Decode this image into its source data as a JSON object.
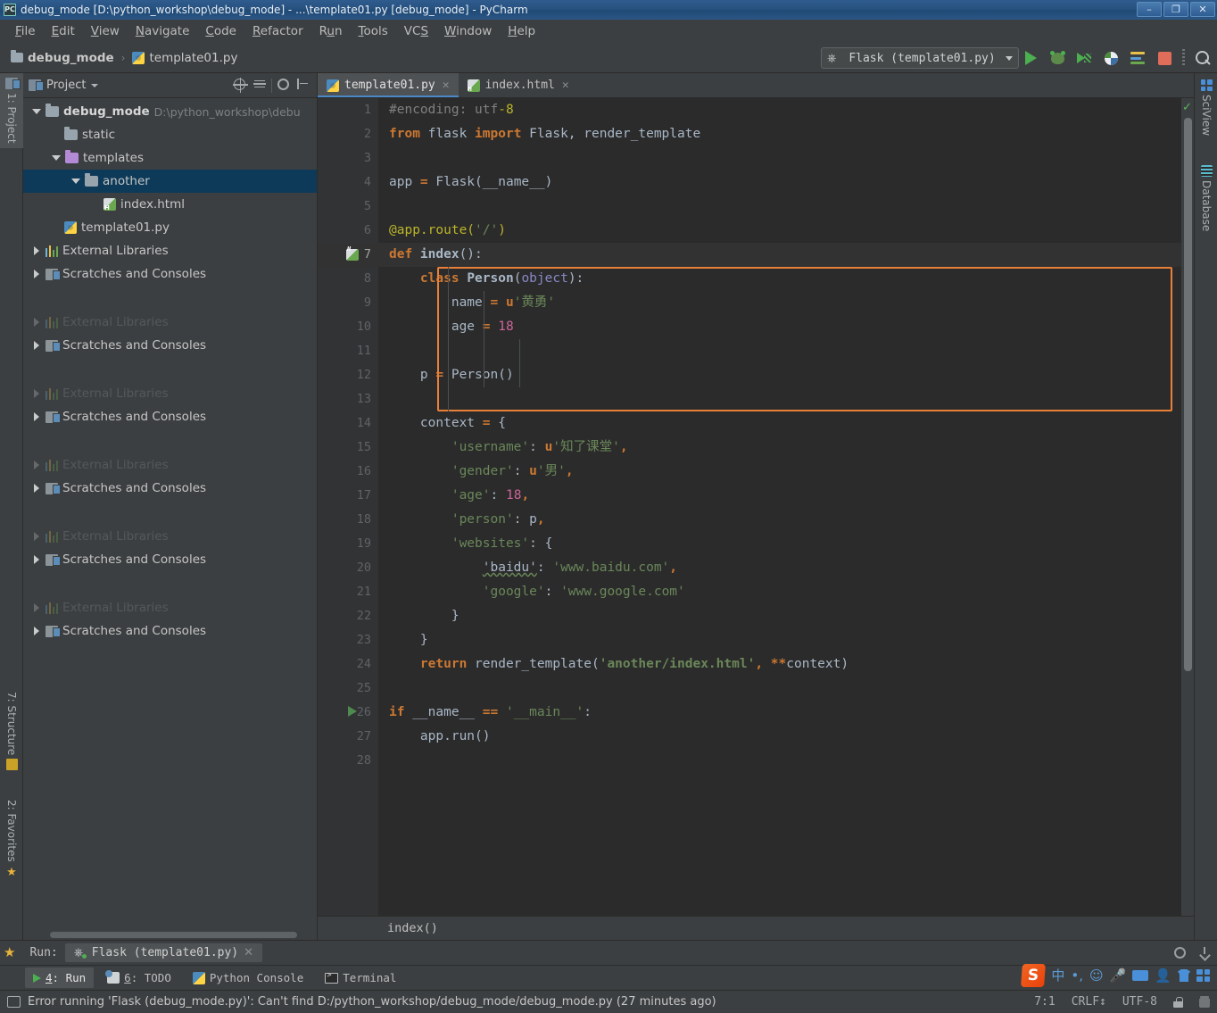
{
  "window": {
    "title": "debug_mode [D:\\python_workshop\\debug_mode] - ...\\template01.py [debug_mode] - PyCharm",
    "app_icon": "PC",
    "minimize": "–",
    "restore": "❐",
    "close": "✕"
  },
  "menu": {
    "items": [
      {
        "label": "File"
      },
      {
        "label": "Edit"
      },
      {
        "label": "View"
      },
      {
        "label": "Navigate"
      },
      {
        "label": "Code"
      },
      {
        "label": "Refactor"
      },
      {
        "label": "Run"
      },
      {
        "label": "Tools"
      },
      {
        "label": "VCS"
      },
      {
        "label": "Window"
      },
      {
        "label": "Help"
      }
    ]
  },
  "navbar": {
    "crumbs": [
      {
        "label": "debug_mode",
        "icon": "folder-icon"
      },
      {
        "label": "template01.py",
        "icon": "python-file-icon"
      }
    ],
    "separator": "›",
    "run_config": "Flask (template01.py)",
    "actions": [
      {
        "name": "run-button",
        "tooltip": "Run"
      },
      {
        "name": "debug-button",
        "tooltip": "Debug"
      },
      {
        "name": "run-coverage-button",
        "tooltip": "Run with Coverage"
      },
      {
        "name": "profile-button",
        "tooltip": "Profile"
      },
      {
        "name": "run-console-button",
        "tooltip": "Console"
      },
      {
        "name": "stop-button",
        "tooltip": "Stop"
      },
      {
        "name": "search-everywhere-button",
        "tooltip": "Search"
      }
    ]
  },
  "left_strip": {
    "project_tab": "1: Project",
    "structure_tab": "7: Structure",
    "favorites_tab": "2: Favorites"
  },
  "right_strip": {
    "sciview_tab": "SciView",
    "database_tab": "Database"
  },
  "project_panel": {
    "title": "Project",
    "toolbar": [
      {
        "name": "locate-icon"
      },
      {
        "name": "collapse-all-icon"
      },
      {
        "name": "settings-gear-icon"
      },
      {
        "name": "hide-panel-icon"
      }
    ],
    "tree": [
      {
        "indent": 0,
        "arrow": "down",
        "icon": "folder-icon",
        "label": "debug_mode",
        "bold": true,
        "path": "D:\\python_workshop\\debu",
        "selected": false
      },
      {
        "indent": 1,
        "arrow": "none",
        "icon": "folder-icon",
        "label": "static",
        "bold": false,
        "path": "",
        "selected": false
      },
      {
        "indent": 1,
        "arrow": "down",
        "icon": "folder-purple-icon",
        "label": "templates",
        "bold": false,
        "path": "",
        "selected": false
      },
      {
        "indent": 2,
        "arrow": "down",
        "icon": "folder-icon",
        "label": "another",
        "bold": false,
        "path": "",
        "selected": true
      },
      {
        "indent": 3,
        "arrow": "none",
        "icon": "html-file-icon",
        "label": "index.html",
        "bold": false,
        "path": "",
        "selected": false
      },
      {
        "indent": 1,
        "arrow": "none",
        "icon": "python-file-icon",
        "label": "template01.py",
        "bold": false,
        "path": "",
        "selected": false
      },
      {
        "indent": 0,
        "arrow": "right",
        "icon": "libraries-icon",
        "label": "External Libraries",
        "bold": false,
        "path": "",
        "selected": false
      },
      {
        "indent": 0,
        "arrow": "right",
        "icon": "scratches-icon",
        "label": "Scratches and Consoles",
        "bold": false,
        "path": "",
        "selected": false
      }
    ],
    "ghost_groups": [
      {
        "library_label": "External Libraries",
        "scratch_label": "Scratches and Consoles"
      },
      {
        "library_label": "External Libraries",
        "scratch_label": "Scratches and Consoles"
      },
      {
        "library_label": "External Libraries",
        "scratch_label": "Scratches and Consoles"
      },
      {
        "library_label": "External Libraries",
        "scratch_label": "Scratches and Consoles"
      },
      {
        "library_label": "External Libraries",
        "scratch_label": "Scratches and Consoles"
      }
    ]
  },
  "editor": {
    "tabs": [
      {
        "label": "template01.py",
        "icon": "python-file-icon",
        "active": true,
        "close": "✕"
      },
      {
        "label": "index.html",
        "icon": "html-file-icon",
        "active": false,
        "close": "✕"
      }
    ],
    "current_line": 7,
    "breadcrumb": "index()",
    "inspection_status": "ok",
    "lines": [
      {
        "n": 1,
        "tokens": [
          {
            "t": "#encoding: ",
            "c": "cmt"
          },
          {
            "t": "utf",
            "c": "cmt"
          },
          {
            "t": "-8",
            "c": "enc"
          }
        ],
        "indent": 0
      },
      {
        "n": 2,
        "tokens": [
          {
            "t": "from ",
            "c": "k"
          },
          {
            "t": "flask ",
            "c": "plain"
          },
          {
            "t": "import ",
            "c": "k"
          },
          {
            "t": "Flask, render_template",
            "c": "plain"
          }
        ],
        "indent": 0
      },
      {
        "n": 3,
        "tokens": [],
        "indent": 0
      },
      {
        "n": 4,
        "tokens": [
          {
            "t": "app ",
            "c": "plain"
          },
          {
            "t": "= ",
            "c": "k"
          },
          {
            "t": "Flask(__name__)",
            "c": "plain"
          }
        ],
        "indent": 0
      },
      {
        "n": 5,
        "tokens": [],
        "indent": 0
      },
      {
        "n": 6,
        "tokens": [
          {
            "t": "@app.route(",
            "c": "deco"
          },
          {
            "t": "'/'",
            "c": "str"
          },
          {
            "t": ")",
            "c": "deco"
          }
        ],
        "indent": 0
      },
      {
        "n": 7,
        "tokens": [
          {
            "t": "def ",
            "c": "k"
          },
          {
            "t": "index",
            "c": "cls"
          },
          {
            "t": "():",
            "c": "plain"
          }
        ],
        "indent": 0,
        "gutter_icon": "html-file-icon"
      },
      {
        "n": 8,
        "tokens": [
          {
            "t": "    ",
            "c": "plain"
          },
          {
            "t": "class ",
            "c": "k"
          },
          {
            "t": "Person",
            "c": "cls"
          },
          {
            "t": "(",
            "c": "plain"
          },
          {
            "t": "object",
            "c": "bi"
          },
          {
            "t": "):",
            "c": "plain"
          }
        ],
        "indent": 1
      },
      {
        "n": 9,
        "tokens": [
          {
            "t": "        name ",
            "c": "plain"
          },
          {
            "t": "= ",
            "c": "k"
          },
          {
            "t": "u",
            "c": "k"
          },
          {
            "t": "'黄勇'",
            "c": "str"
          }
        ],
        "indent": 2
      },
      {
        "n": 10,
        "tokens": [
          {
            "t": "        age ",
            "c": "plain"
          },
          {
            "t": "= ",
            "c": "k"
          },
          {
            "t": "18",
            "c": "numpink"
          }
        ],
        "indent": 2
      },
      {
        "n": 11,
        "tokens": [],
        "indent": 0
      },
      {
        "n": 12,
        "tokens": [
          {
            "t": "    p ",
            "c": "plain"
          },
          {
            "t": "= ",
            "c": "k"
          },
          {
            "t": "Person()",
            "c": "plain"
          }
        ],
        "indent": 1
      },
      {
        "n": 13,
        "tokens": [],
        "indent": 0
      },
      {
        "n": 14,
        "tokens": [
          {
            "t": "    context ",
            "c": "plain"
          },
          {
            "t": "= ",
            "c": "k"
          },
          {
            "t": "{",
            "c": "plain"
          }
        ],
        "indent": 1
      },
      {
        "n": 15,
        "tokens": [
          {
            "t": "        ",
            "c": "plain"
          },
          {
            "t": "'username'",
            "c": "str"
          },
          {
            "t": ": ",
            "c": "plain"
          },
          {
            "t": "u",
            "c": "k"
          },
          {
            "t": "'知了课堂'",
            "c": "str"
          },
          {
            "t": ",",
            "c": "k"
          }
        ],
        "indent": 2
      },
      {
        "n": 16,
        "tokens": [
          {
            "t": "        ",
            "c": "plain"
          },
          {
            "t": "'gender'",
            "c": "str"
          },
          {
            "t": ": ",
            "c": "plain"
          },
          {
            "t": "u",
            "c": "k"
          },
          {
            "t": "'男'",
            "c": "str"
          },
          {
            "t": ",",
            "c": "k"
          }
        ],
        "indent": 2
      },
      {
        "n": 17,
        "tokens": [
          {
            "t": "        ",
            "c": "plain"
          },
          {
            "t": "'age'",
            "c": "str"
          },
          {
            "t": ": ",
            "c": "plain"
          },
          {
            "t": "18",
            "c": "numpink"
          },
          {
            "t": ",",
            "c": "k"
          }
        ],
        "indent": 2
      },
      {
        "n": 18,
        "tokens": [
          {
            "t": "        ",
            "c": "plain"
          },
          {
            "t": "'person'",
            "c": "str"
          },
          {
            "t": ": p",
            "c": "plain"
          },
          {
            "t": ",",
            "c": "k"
          }
        ],
        "indent": 2
      },
      {
        "n": 19,
        "tokens": [
          {
            "t": "        ",
            "c": "plain"
          },
          {
            "t": "'websites'",
            "c": "str"
          },
          {
            "t": ": {",
            "c": "plain"
          }
        ],
        "indent": 2
      },
      {
        "n": 20,
        "tokens": [
          {
            "t": "            ",
            "c": "plain"
          },
          {
            "t": "'baidu'",
            "c": "spell"
          },
          {
            "t": ": ",
            "c": "plain"
          },
          {
            "t": "'www.baidu.com'",
            "c": "str"
          },
          {
            "t": ",",
            "c": "k"
          }
        ],
        "indent": 3
      },
      {
        "n": 21,
        "tokens": [
          {
            "t": "            ",
            "c": "plain"
          },
          {
            "t": "'google'",
            "c": "str"
          },
          {
            "t": ": ",
            "c": "plain"
          },
          {
            "t": "'www.google.com'",
            "c": "str"
          }
        ],
        "indent": 3
      },
      {
        "n": 22,
        "tokens": [
          {
            "t": "        }",
            "c": "plain"
          }
        ],
        "indent": 2
      },
      {
        "n": 23,
        "tokens": [
          {
            "t": "    }",
            "c": "plain"
          }
        ],
        "indent": 1
      },
      {
        "n": 24,
        "tokens": [
          {
            "t": "    ",
            "c": "plain"
          },
          {
            "t": "return ",
            "c": "k"
          },
          {
            "t": "render_template(",
            "c": "plain"
          },
          {
            "t": "'another/index.html'",
            "c": "hl-str"
          },
          {
            "t": ", ",
            "c": "k"
          },
          {
            "t": "**",
            "c": "k"
          },
          {
            "t": "context)",
            "c": "plain"
          }
        ],
        "indent": 1
      },
      {
        "n": 25,
        "tokens": [],
        "indent": 0
      },
      {
        "n": 26,
        "tokens": [
          {
            "t": "if ",
            "c": "k"
          },
          {
            "t": "__name__ ",
            "c": "plain"
          },
          {
            "t": "== ",
            "c": "k"
          },
          {
            "t": "'__main__'",
            "c": "str"
          },
          {
            "t": ":",
            "c": "plain"
          }
        ],
        "indent": 0,
        "gutter_icon": "run-marker-icon"
      },
      {
        "n": 27,
        "tokens": [
          {
            "t": "    app.run()",
            "c": "plain"
          }
        ],
        "indent": 1
      },
      {
        "n": 28,
        "tokens": [],
        "indent": 0
      }
    ]
  },
  "run_panel": {
    "label": "Run:",
    "tab_label": "Flask (template01.py)",
    "close": "✕",
    "actions": [
      {
        "name": "settings-gear-icon"
      },
      {
        "name": "export-icon"
      }
    ]
  },
  "bottom_tabs": [
    {
      "label": "4: Run",
      "icon": "run-icon",
      "selected": true
    },
    {
      "label": "6: TODO",
      "icon": "todo-icon",
      "selected": false
    },
    {
      "label": "Python Console",
      "icon": "python-icon",
      "selected": false
    },
    {
      "label": "Terminal",
      "icon": "terminal-icon",
      "selected": false
    }
  ],
  "ime": {
    "logo": "S",
    "mode": "中",
    "items": [
      "punctuation-icon",
      "emoji-icon",
      "microphone-icon",
      "keyboard-icon",
      "user-icon",
      "skin-icon",
      "apps-icon"
    ]
  },
  "statusbar": {
    "message": "Error running 'Flask (debug_mode.py)': Can't find D:/python_workshop/debug_mode/debug_mode.py (27 minutes ago)",
    "caret_position": "7:1",
    "line_separator": "CRLF",
    "encoding": "UTF-8",
    "lock_icon": "lock-icon",
    "trash_icon": "trash-icon"
  },
  "colors": {
    "accent_blue": "#4a88c7",
    "fold_orange": "#e8803a",
    "selection_blue": "#0d3a58",
    "editor_bg": "#2b2b2b",
    "panel_bg": "#3c3f41"
  }
}
